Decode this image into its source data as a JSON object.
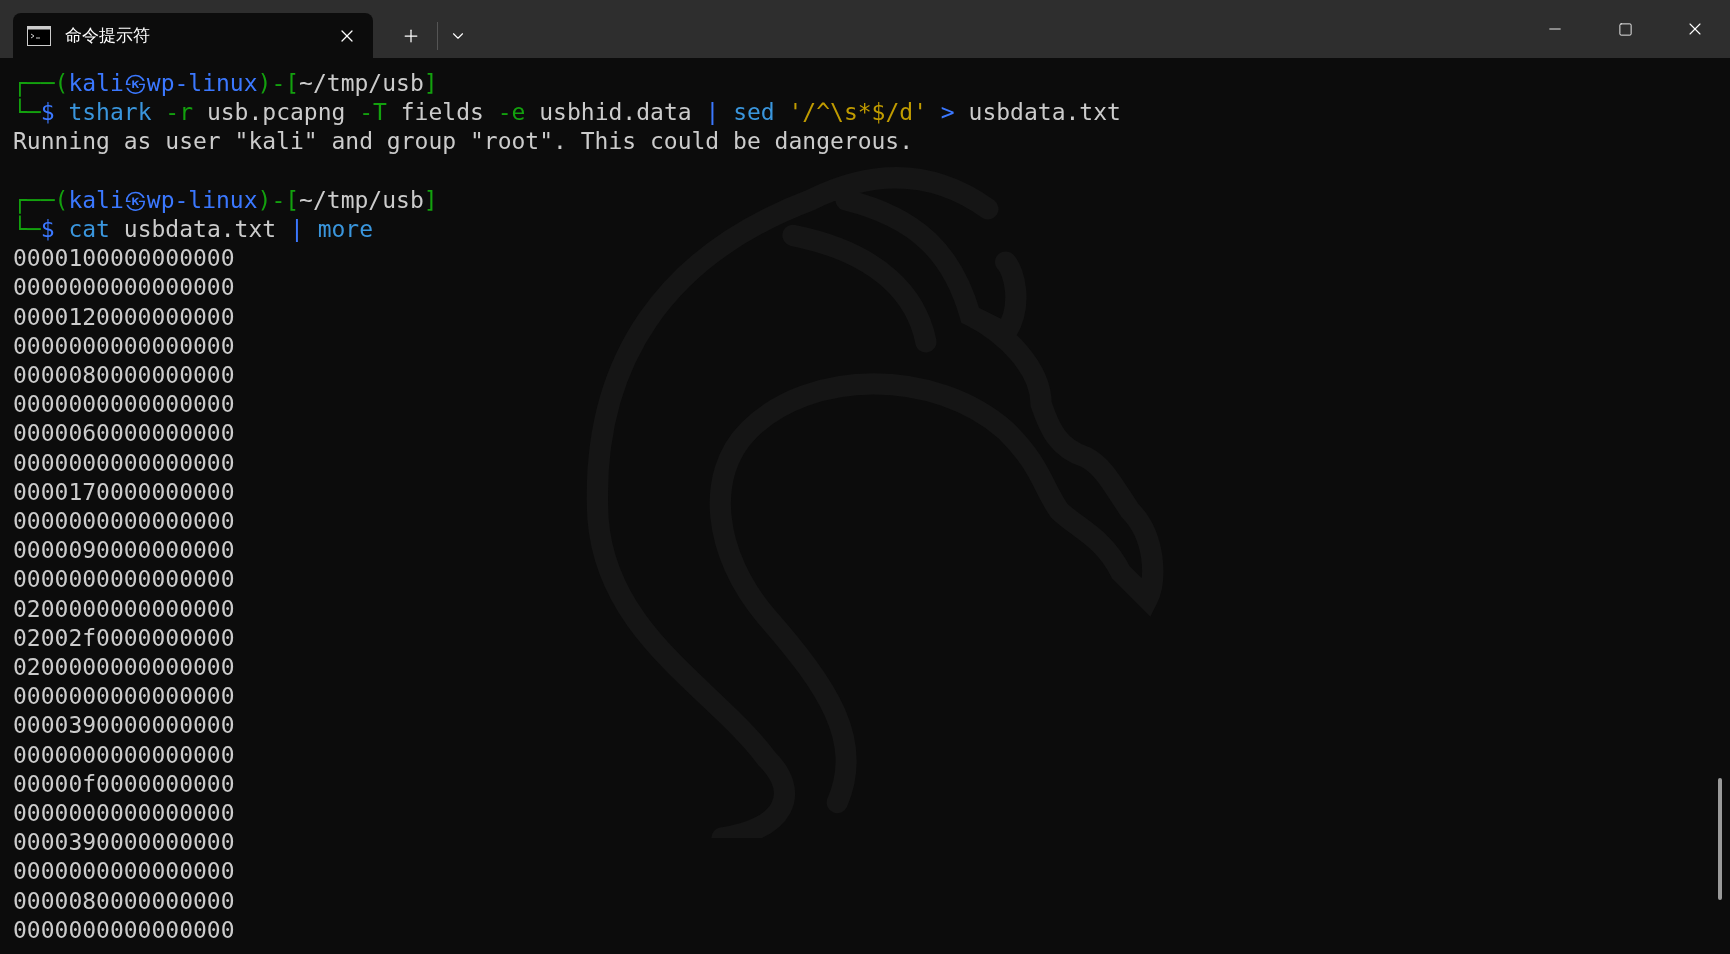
{
  "tabs": [
    {
      "title": "命令提示符",
      "selected": true
    }
  ],
  "terminal": {
    "lines": [
      {
        "segments": [
          {
            "kind": "frame",
            "text": "┌──("
          },
          {
            "kind": "prompt",
            "text": "kali㉿wp-linux"
          },
          {
            "kind": "frame",
            "text": ")-["
          },
          {
            "kind": "plain",
            "text": "~/tmp/usb"
          },
          {
            "kind": "frame",
            "text": "]"
          }
        ]
      },
      {
        "segments": [
          {
            "kind": "frame",
            "text": "└─"
          },
          {
            "kind": "prompt",
            "text": "$ "
          },
          {
            "kind": "command",
            "text": "tshark"
          },
          {
            "kind": "flag",
            "text": " -r"
          },
          {
            "kind": "plain",
            "text": " usb.pcapng "
          },
          {
            "kind": "flag",
            "text": "-T"
          },
          {
            "kind": "plain",
            "text": " fields "
          },
          {
            "kind": "flag",
            "text": "-e"
          },
          {
            "kind": "plain",
            "text": " usbhid.data "
          },
          {
            "kind": "operator",
            "text": "|"
          },
          {
            "kind": "command",
            "text": " sed"
          },
          {
            "kind": "string",
            "text": " '/^\\s*$/d'"
          },
          {
            "kind": "operator",
            "text": " >"
          },
          {
            "kind": "plain",
            "text": " usbdata.txt"
          }
        ]
      },
      {
        "segments": [
          {
            "kind": "plain",
            "text": "Running as user \"kali\" and group \"root\". This could be dangerous."
          }
        ]
      },
      {
        "blank_before": true,
        "segments": [
          {
            "kind": "frame",
            "text": "┌──("
          },
          {
            "kind": "prompt",
            "text": "kali㉿wp-linux"
          },
          {
            "kind": "frame",
            "text": ")-["
          },
          {
            "kind": "plain",
            "text": "~/tmp/usb"
          },
          {
            "kind": "frame",
            "text": "]"
          }
        ]
      },
      {
        "segments": [
          {
            "kind": "frame",
            "text": "└─"
          },
          {
            "kind": "prompt",
            "text": "$ "
          },
          {
            "kind": "command",
            "text": "cat"
          },
          {
            "kind": "plain",
            "text": " usbdata.txt "
          },
          {
            "kind": "operator",
            "text": "|"
          },
          {
            "kind": "command",
            "text": " more"
          }
        ]
      },
      {
        "segments": [
          {
            "kind": "plain",
            "text": "0000100000000000"
          }
        ]
      },
      {
        "segments": [
          {
            "kind": "plain",
            "text": "0000000000000000"
          }
        ]
      },
      {
        "segments": [
          {
            "kind": "plain",
            "text": "0000120000000000"
          }
        ]
      },
      {
        "segments": [
          {
            "kind": "plain",
            "text": "0000000000000000"
          }
        ]
      },
      {
        "segments": [
          {
            "kind": "plain",
            "text": "0000080000000000"
          }
        ]
      },
      {
        "segments": [
          {
            "kind": "plain",
            "text": "0000000000000000"
          }
        ]
      },
      {
        "segments": [
          {
            "kind": "plain",
            "text": "0000060000000000"
          }
        ]
      },
      {
        "segments": [
          {
            "kind": "plain",
            "text": "0000000000000000"
          }
        ]
      },
      {
        "segments": [
          {
            "kind": "plain",
            "text": "0000170000000000"
          }
        ]
      },
      {
        "segments": [
          {
            "kind": "plain",
            "text": "0000000000000000"
          }
        ]
      },
      {
        "segments": [
          {
            "kind": "plain",
            "text": "0000090000000000"
          }
        ]
      },
      {
        "segments": [
          {
            "kind": "plain",
            "text": "0000000000000000"
          }
        ]
      },
      {
        "segments": [
          {
            "kind": "plain",
            "text": "0200000000000000"
          }
        ]
      },
      {
        "segments": [
          {
            "kind": "plain",
            "text": "02002f0000000000"
          }
        ]
      },
      {
        "segments": [
          {
            "kind": "plain",
            "text": "0200000000000000"
          }
        ]
      },
      {
        "segments": [
          {
            "kind": "plain",
            "text": "0000000000000000"
          }
        ]
      },
      {
        "segments": [
          {
            "kind": "plain",
            "text": "0000390000000000"
          }
        ]
      },
      {
        "segments": [
          {
            "kind": "plain",
            "text": "0000000000000000"
          }
        ]
      },
      {
        "segments": [
          {
            "kind": "plain",
            "text": "00000f0000000000"
          }
        ]
      },
      {
        "segments": [
          {
            "kind": "plain",
            "text": "0000000000000000"
          }
        ]
      },
      {
        "segments": [
          {
            "kind": "plain",
            "text": "0000390000000000"
          }
        ]
      },
      {
        "segments": [
          {
            "kind": "plain",
            "text": "0000000000000000"
          }
        ]
      },
      {
        "segments": [
          {
            "kind": "plain",
            "text": "0000080000000000"
          }
        ]
      },
      {
        "segments": [
          {
            "kind": "plain",
            "text": "0000000000000000"
          }
        ]
      }
    ]
  }
}
